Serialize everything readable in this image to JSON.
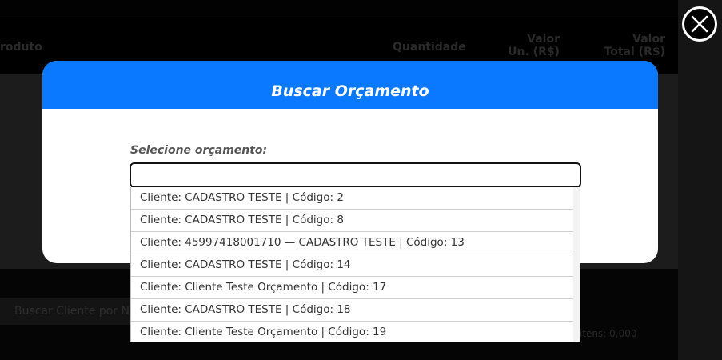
{
  "background": {
    "header_columns": {
      "product": "roduto",
      "quantity": "Quantidade",
      "unit_value": "Valor Un. (R$)",
      "total_value": "Valor Total (R$)"
    },
    "search_client_button": "Buscar Cliente por N",
    "items_total": "itens: 0,000"
  },
  "modal": {
    "title": "Buscar Orçamento",
    "field_label": "Selecione orçamento:",
    "input_value": "",
    "options": [
      "Cliente: CADASTRO TESTE | Código: 2",
      "Cliente: CADASTRO TESTE | Código: 8",
      "Cliente: 45997418001710 — CADASTRO TESTE | Código: 13",
      "Cliente: CADASTRO TESTE | Código: 14",
      "Cliente: Cliente Teste Orçamento | Código: 17",
      "Cliente: CADASTRO TESTE | Código: 18",
      "Cliente: Cliente Teste Orçamento | Código: 19"
    ]
  },
  "icons": {
    "close": "close-icon"
  },
  "colors": {
    "modal_header": "#0a78ff",
    "modal_body": "#ffffff",
    "overlay": "#000000"
  }
}
